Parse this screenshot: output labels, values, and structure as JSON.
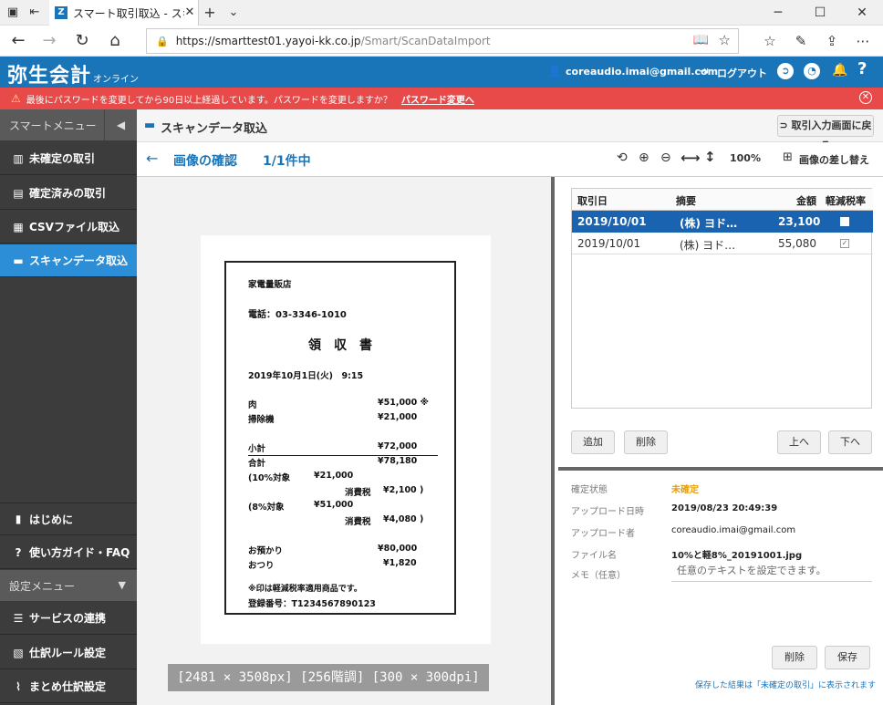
{
  "browser": {
    "tab_title": "スマート取引取込 - スキャン",
    "favicon_letter": "Z",
    "url_host": "https://smarttest01.yayoi-kk.co.jp",
    "url_path": "/Smart/ScanDataImport"
  },
  "app": {
    "logo": "弥生会計",
    "logo_sub": "オンライン",
    "user_email": "coreaudio.imai@gmail.com",
    "logout_label": "ログアウト"
  },
  "warning": {
    "message": "最後にパスワードを変更してから90日以上経過しています。パスワードを変更しますか？",
    "link": "パスワード変更へ"
  },
  "sidebar": {
    "smart_menu": "スマートメニュー",
    "items": [
      {
        "label": "未確定の取引",
        "icon": "ledger-icon"
      },
      {
        "label": "確定済みの取引",
        "icon": "document-icon"
      },
      {
        "label": "CSVファイル取込",
        "icon": "csv-icon"
      },
      {
        "label": "スキャンデータ取込",
        "icon": "scanner-icon"
      }
    ],
    "intro": "はじめに",
    "guide": "使い方ガイド・FAQ",
    "settings_menu": "設定メニュー",
    "settings_items": [
      {
        "label": "サービスの連携",
        "icon": "link-icon"
      },
      {
        "label": "仕訳ルール設定",
        "icon": "rule-icon"
      },
      {
        "label": "まとめ仕訳設定",
        "icon": "clip-icon"
      }
    ]
  },
  "main": {
    "page_title": "スキャンデータ取込",
    "back_to_input": "取引入力画面に戻る",
    "subtitle": "画像の確認",
    "count": "1/1件中",
    "zoom": "100%",
    "replace_image": "画像の差し替え",
    "image_info": "[2481 × 3508px] [256階調] [300 × 300dpi]"
  },
  "receipt": {
    "shop": "家電量販店",
    "tel": "電話：03-3346-1010",
    "heading": "領　収　書",
    "datetime": "2019年10月1日(火)　9:15",
    "lines": [
      {
        "name": "肉",
        "amount": "¥51,000 ※"
      },
      {
        "name": "掃除機",
        "amount": "¥21,000"
      }
    ],
    "subtotal_label": "小計",
    "subtotal": "¥72,000",
    "total_label": "合計",
    "total": "¥78,180",
    "tax10_label": "(10%対象",
    "tax10_base": "¥21,000",
    "tax10_tax_label": "消費税",
    "tax10_tax": "¥2,100 )",
    "tax8_label": "(8%対象",
    "tax8_base": "¥51,000",
    "tax8_tax_label": "消費税",
    "tax8_tax": "¥4,080 )",
    "paid_label": "お預かり",
    "paid": "¥80,000",
    "change_label": "おつり",
    "change": "¥1,820",
    "note": "※印は軽減税率適用商品です。",
    "reg": "登録番号：T1234567890123"
  },
  "table": {
    "headers": {
      "date": "取引日",
      "summary": "摘要",
      "amount": "金額",
      "reduced": "軽減税率"
    },
    "rows": [
      {
        "date": "2019/10/01",
        "summary": "(株) ヨド…",
        "amount": "23,100",
        "reduced": false,
        "selected": true
      },
      {
        "date": "2019/10/01",
        "summary": "(株) ヨド…",
        "amount": "55,080",
        "reduced": true,
        "selected": false
      }
    ],
    "add": "追加",
    "delete": "削除",
    "up": "上へ",
    "down": "下へ"
  },
  "detail": {
    "status_label": "確定状態",
    "status": "未確定",
    "upload_date_label": "アップロード日時",
    "upload_date": "2019/08/23 20:49:39",
    "uploader_label": "アップロード者",
    "uploader": "coreaudio.imai@gmail.com",
    "filename_label": "ファイル名",
    "filename": "10%と軽8%_20191001.jpg",
    "memo_label": "メモ（任意）",
    "memo_placeholder": "任意のテキストを設定できます。",
    "delete": "削除",
    "save": "保存",
    "save_note": "保存した結果は「未確定の取引」に表示されます"
  }
}
